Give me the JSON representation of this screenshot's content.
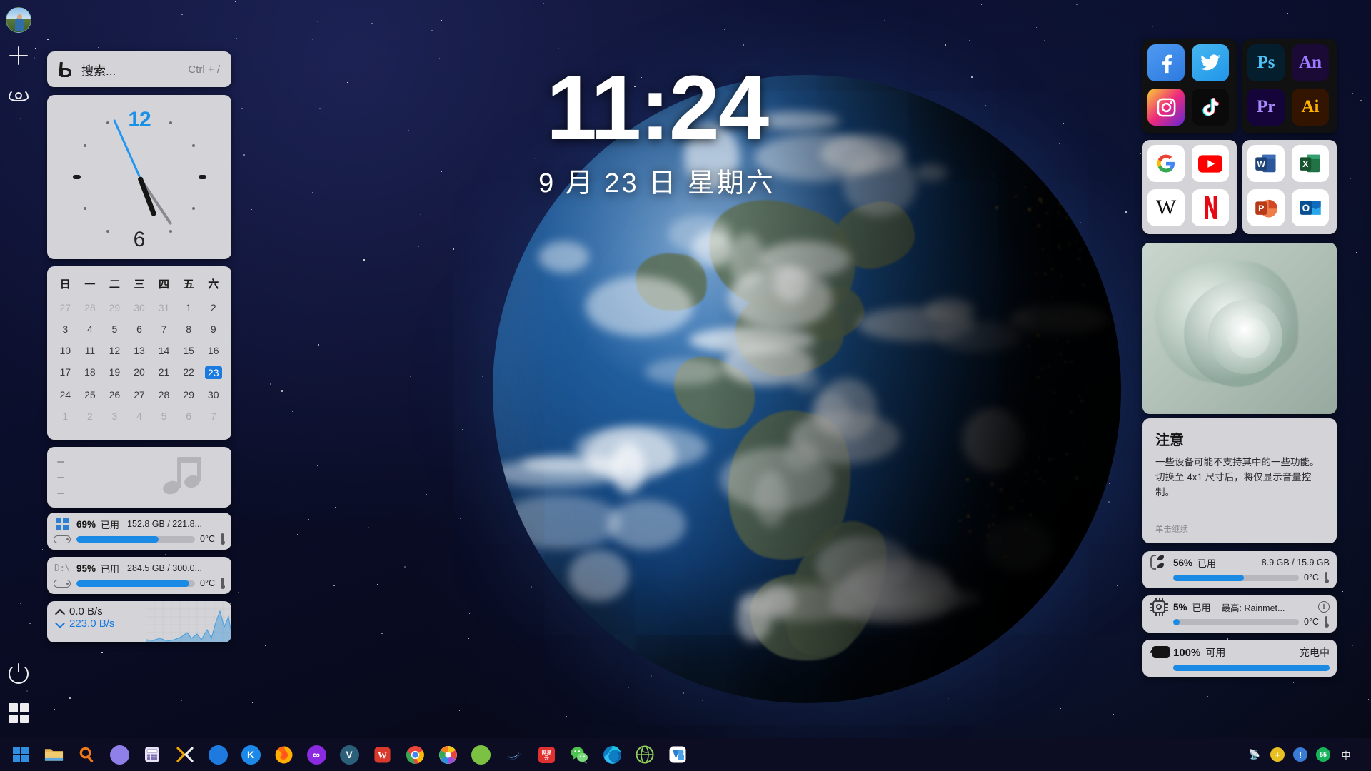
{
  "desktop": {
    "center_clock": {
      "time": "11:24",
      "date": "9 月 23 日 星期六"
    }
  },
  "launchbar": {
    "avatar_name": "user-avatar",
    "add_label": "+",
    "icons": [
      "plus-icon",
      "eye-icon",
      "power-icon",
      "start-icon"
    ]
  },
  "search": {
    "placeholder": "搜索...",
    "shortcut": "Ctrl + /",
    "icon": "bing-icon"
  },
  "clock_widget": {
    "top_number": "12",
    "bottom_number": "6"
  },
  "calendar": {
    "weekdays": [
      "日",
      "一",
      "二",
      "三",
      "四",
      "五",
      "六"
    ],
    "selected": "23",
    "rows": [
      [
        {
          "d": "27",
          "dim": true
        },
        {
          "d": "28",
          "dim": true
        },
        {
          "d": "29",
          "dim": true
        },
        {
          "d": "30",
          "dim": true
        },
        {
          "d": "31",
          "dim": true
        },
        {
          "d": "1"
        },
        {
          "d": "2"
        }
      ],
      [
        {
          "d": "3"
        },
        {
          "d": "4"
        },
        {
          "d": "5"
        },
        {
          "d": "6"
        },
        {
          "d": "7"
        },
        {
          "d": "8"
        },
        {
          "d": "9"
        }
      ],
      [
        {
          "d": "10"
        },
        {
          "d": "11"
        },
        {
          "d": "12"
        },
        {
          "d": "13"
        },
        {
          "d": "14"
        },
        {
          "d": "15"
        },
        {
          "d": "16"
        }
      ],
      [
        {
          "d": "17"
        },
        {
          "d": "18"
        },
        {
          "d": "19"
        },
        {
          "d": "20"
        },
        {
          "d": "21"
        },
        {
          "d": "22"
        },
        {
          "d": "23",
          "sel": true
        }
      ],
      [
        {
          "d": "24"
        },
        {
          "d": "25"
        },
        {
          "d": "26"
        },
        {
          "d": "27"
        },
        {
          "d": "28"
        },
        {
          "d": "29"
        },
        {
          "d": "30"
        }
      ],
      [
        {
          "d": "1",
          "dim": true
        },
        {
          "d": "2",
          "dim": true
        },
        {
          "d": "3",
          "dim": true
        },
        {
          "d": "4",
          "dim": true
        },
        {
          "d": "5",
          "dim": true
        },
        {
          "d": "6",
          "dim": true
        },
        {
          "d": "7",
          "dim": true
        }
      ]
    ]
  },
  "media_widget": {
    "icon": "music-note-icon"
  },
  "disks": [
    {
      "name": "disk-c",
      "icon": "windows-logo-icon",
      "percent": "69%",
      "used_label": "已用",
      "sizes": "152.8 GB / 221.8...",
      "temp": "0°C",
      "fill": 69
    },
    {
      "name": "disk-d",
      "icon": "drive-letter",
      "label": "D:\\",
      "percent": "95%",
      "used_label": "已用",
      "sizes": "284.5 GB / 300.0...",
      "temp": "0°C",
      "fill": 95
    }
  ],
  "network": {
    "upload": "0.0 B/s",
    "download": "223.0 B/s"
  },
  "right_panel": {
    "social_apps": [
      {
        "name": "facebook",
        "label": "f",
        "bg": "linear-gradient(145deg,#4e9af1,#2d7ae0)",
        "color": "#ffffff"
      },
      {
        "name": "twitter",
        "label": "",
        "bg": "linear-gradient(145deg,#46b6f0,#2196e8)",
        "color": "#ffffff"
      },
      {
        "name": "instagram",
        "label": "",
        "bg": "linear-gradient(135deg,#f9ce34,#ee2a7b,#6228d7)",
        "color": "#ffffff"
      },
      {
        "name": "tiktok",
        "label": "",
        "bg": "#0a0a0a",
        "color": "#ffffff"
      }
    ],
    "adobe_apps": [
      {
        "name": "photoshop",
        "label": "Ps",
        "bg": "#041e2d",
        "color": "#4ec3f7"
      },
      {
        "name": "animate",
        "label": "An",
        "bg": "#1b0a35",
        "color": "#9b7bff"
      },
      {
        "name": "premiere",
        "label": "Pr",
        "bg": "#14043a",
        "color": "#a78bfa"
      },
      {
        "name": "illustrator",
        "label": "Ai",
        "bg": "#331400",
        "color": "#ffb300"
      }
    ],
    "web_apps": [
      {
        "name": "google",
        "label": "G",
        "bg": "#ffffff",
        "color": "#4285f4"
      },
      {
        "name": "youtube",
        "label": "",
        "bg": "#ffffff",
        "color": "#ff0000"
      },
      {
        "name": "wikipedia",
        "label": "W",
        "bg": "#ffffff",
        "color": "#111111"
      },
      {
        "name": "netflix",
        "label": "N",
        "bg": "#ffffff",
        "color": "#e50914"
      }
    ],
    "office_apps": [
      {
        "name": "word",
        "label": "W",
        "bg": "#ffffff",
        "color": "#2b579a"
      },
      {
        "name": "excel",
        "label": "X",
        "bg": "#ffffff",
        "color": "#217346"
      },
      {
        "name": "powerpoint",
        "label": "P",
        "bg": "#ffffff",
        "color": "#d24726"
      },
      {
        "name": "outlook",
        "label": "O",
        "bg": "#ffffff",
        "color": "#0f6cbd"
      }
    ],
    "notice": {
      "title": "注意",
      "body": "一些设备可能不支持其中的一些功能。切换至 4x1 尺寸后，将仅显示音量控制。",
      "footer": "单击继续"
    },
    "ram": {
      "percent": "56%",
      "used_label": "已用",
      "sizes": "8.9 GB / 15.9 GB",
      "temp": "0°C",
      "fill": 56
    },
    "cpu": {
      "percent": "5%",
      "used_label": "已用",
      "top_label": "最高: Rainmet...",
      "temp": "0°C",
      "fill": 5
    },
    "battery": {
      "percent": "100%",
      "status_label": "可用",
      "charging": "充电中",
      "fill": 100
    }
  },
  "taskbar": {
    "items": [
      {
        "name": "start-button",
        "label": "",
        "kind": "win"
      },
      {
        "name": "file-explorer",
        "label": "",
        "kind": "folder"
      },
      {
        "name": "search-button",
        "label": "",
        "kind": "searchglass"
      },
      {
        "name": "cortana",
        "label": "",
        "kind": "circle",
        "bg": "#8f7fe8"
      },
      {
        "name": "calculator",
        "label": "",
        "kind": "calc"
      },
      {
        "name": "xmind",
        "label": "",
        "kind": "xmind"
      },
      {
        "name": "moon-app",
        "label": "",
        "kind": "circle",
        "bg": "#1f7ae0"
      },
      {
        "name": "kugou",
        "label": "K",
        "kind": "circle",
        "bg": "#1c88e8"
      },
      {
        "name": "firefox",
        "label": "",
        "kind": "firefox"
      },
      {
        "name": "infinity-app",
        "label": "∞",
        "kind": "circle",
        "bg": "#8a2be2"
      },
      {
        "name": "v-app",
        "label": "V",
        "kind": "circle",
        "bg": "#2c5f7a"
      },
      {
        "name": "wps-office",
        "label": "W",
        "kind": "wps"
      },
      {
        "name": "chrome",
        "label": "",
        "kind": "chrome"
      },
      {
        "name": "photos",
        "label": "",
        "kind": "photos"
      },
      {
        "name": "green-app",
        "label": "",
        "kind": "circle",
        "bg": "#7cc242"
      },
      {
        "name": "blue-swoosh",
        "label": "",
        "kind": "swoosh"
      },
      {
        "name": "netease-music",
        "label": "网易云",
        "kind": "netease"
      },
      {
        "name": "wechat",
        "label": "",
        "kind": "wechat"
      },
      {
        "name": "edge",
        "label": "",
        "kind": "edge"
      },
      {
        "name": "globe-app",
        "label": "",
        "kind": "globe"
      },
      {
        "name": "teams-app",
        "label": "",
        "kind": "teams"
      }
    ],
    "tray": [
      {
        "name": "satellite-icon",
        "glyph": "📡"
      },
      {
        "name": "update-icon",
        "glyph": "+",
        "bg": "#e8c021"
      },
      {
        "name": "warning-icon",
        "glyph": "!",
        "bg": "#3a7bd5"
      },
      {
        "name": "score-icon",
        "glyph": "55",
        "bg": "#19b35c"
      },
      {
        "name": "ime-icon",
        "glyph": "中"
      }
    ]
  }
}
